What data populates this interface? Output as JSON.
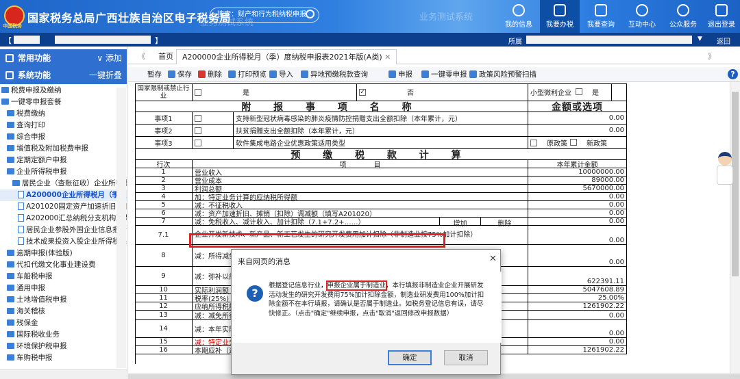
{
  "header": {
    "logo_text": "中国税务",
    "site_title": "国家税务总局广西壮族自治区电子税务局",
    "search_placeholder": "搜索：财产和行为税纳税申报",
    "watermark_left": "业务测试系统",
    "watermark_right": "业务测试系统",
    "nav": [
      {
        "label": "我的信息",
        "icon": "user-icon"
      },
      {
        "label": "我要办税",
        "icon": "monitor-icon",
        "active": true
      },
      {
        "label": "我要查询",
        "icon": "document-search-icon"
      },
      {
        "label": "互动中心",
        "icon": "chat-icon"
      },
      {
        "label": "公众服务",
        "icon": "service-icon"
      },
      {
        "label": "退出登录",
        "icon": "logout-icon"
      }
    ]
  },
  "subbar": {
    "left_bracket": "【",
    "right_bracket": "】",
    "org_label": "所属",
    "back_label": "返回"
  },
  "sidebar": {
    "common_label": "常用功能",
    "common_action": "添加",
    "system_label": "系统功能",
    "system_action": "一键折叠",
    "items": [
      {
        "label": "税费申报及缴纳",
        "indent": 0,
        "type": "folder"
      },
      {
        "label": "一键零申报套餐",
        "indent": 0,
        "type": "folder"
      },
      {
        "label": "税费缴纳",
        "indent": 1,
        "type": "folder"
      },
      {
        "label": "查询打印",
        "indent": 1,
        "type": "folder"
      },
      {
        "label": "综合申报",
        "indent": 1,
        "type": "folder"
      },
      {
        "label": "增值税及附加税费申报",
        "indent": 1,
        "type": "folder"
      },
      {
        "label": "定期定额户申报",
        "indent": 1,
        "type": "folder"
      },
      {
        "label": "企业所得税申报",
        "indent": 1,
        "type": "folder"
      },
      {
        "label": "居民企业（查账征收）企业所得税",
        "indent": 2,
        "type": "folder"
      },
      {
        "label": "A200000企业所得税月（季）度",
        "indent": 3,
        "type": "doc",
        "selected": true
      },
      {
        "label": "A201020固定资产加速折旧(扣除",
        "indent": 3,
        "type": "doc"
      },
      {
        "label": "A202000汇总纳税分支机构所得税",
        "indent": 3,
        "type": "doc"
      },
      {
        "label": "居民企业参股外国企业信息报告表",
        "indent": 3,
        "type": "doc"
      },
      {
        "label": "技术成果投资入股企业所得税递延",
        "indent": 3,
        "type": "doc"
      },
      {
        "label": "逾期申报(体验版)",
        "indent": 1,
        "type": "folder"
      },
      {
        "label": "代扣代缴文化事业建设费",
        "indent": 1,
        "type": "folder"
      },
      {
        "label": "车船税申报",
        "indent": 1,
        "type": "folder"
      },
      {
        "label": "通用申报",
        "indent": 1,
        "type": "folder"
      },
      {
        "label": "土地增值税申报",
        "indent": 1,
        "type": "folder"
      },
      {
        "label": "海关稽核",
        "indent": 1,
        "type": "folder"
      },
      {
        "label": "残保金",
        "indent": 1,
        "type": "folder"
      },
      {
        "label": "国际税收业务",
        "indent": 1,
        "type": "folder"
      },
      {
        "label": "环境保护税申报",
        "indent": 1,
        "type": "folder"
      },
      {
        "label": "车购税申报",
        "indent": 1,
        "type": "folder"
      }
    ]
  },
  "tabs": {
    "home": "首页",
    "active": "A200000企业所得税月（季）度纳税申报表2021年版(A类)",
    "prev": "《",
    "next": "》"
  },
  "toolbar": [
    {
      "label": "暂存",
      "icon": "none"
    },
    {
      "label": "保存",
      "icon": "save-icon"
    },
    {
      "label": "删除",
      "icon": "delete-icon"
    },
    {
      "label": "打印预览",
      "icon": "print-icon"
    },
    {
      "label": "导入",
      "icon": "import-icon"
    },
    {
      "label": "异地预缴税款查询",
      "icon": "query-icon"
    },
    {
      "label": "申报",
      "icon": "declare-icon"
    },
    {
      "label": "一键零申报",
      "icon": "zero-declare-icon"
    },
    {
      "label": "政策风险预警扫描",
      "icon": "scan-icon"
    }
  ],
  "form": {
    "restricted_label": "国家限制或禁止行业",
    "yes": "是",
    "no": "否",
    "small_profit_label": "小型微利企业",
    "section1_title": "附 报 事 项 名 称",
    "section1_amount": "金额或选项",
    "matters": [
      {
        "label": "事项1",
        "text": "支持新型冠状病毒感染的肺炎疫情防控捐赠支出全额扣除（本年累计，元）",
        "value": "0.00"
      },
      {
        "label": "事项2",
        "text": "扶贫捐赠支出全额扣除（本年累计，元）",
        "value": "0.00"
      },
      {
        "label": "事项3",
        "text": "软件集成电路企业优惠政策适用类型",
        "opt1": "原政策",
        "opt2": "新政策"
      }
    ],
    "section2_title": "预 缴 税 款 计 算",
    "col_no": "行次",
    "col_item": "项　　　　目",
    "col_amount": "本年累计金额",
    "add_label": "增加",
    "del_label": "删除",
    "rows": [
      {
        "no": "1",
        "item": "营业收入",
        "value": "10000000.00"
      },
      {
        "no": "2",
        "item": "营业成本",
        "value": "89000.00"
      },
      {
        "no": "3",
        "item": "利润总额",
        "value": "5670000.00"
      },
      {
        "no": "4",
        "item": "加：特定业务计算的应纳税所得额",
        "value": "0.00"
      },
      {
        "no": "5",
        "item": "减：不征税收入",
        "value": "0.00"
      },
      {
        "no": "6",
        "item": "减：资产加速折旧、摊销（扣除）调减额（填写A201020）",
        "value": "0.00"
      },
      {
        "no": "7",
        "item": "减：免税收入、减计收入、加计扣除（7.1+7.2+……）",
        "value": "0.00"
      },
      {
        "no": "7.1",
        "item": "企业开发新技术、新产品、新工艺发生的研究开发费用加计扣除（非制造业按75%加计扣除）",
        "value": "0.00"
      },
      {
        "no": "8",
        "item": "减：所得减免",
        "value": "0.00"
      },
      {
        "no": "9",
        "item": "减：弥补以前",
        "value": "622391.11"
      },
      {
        "no": "10",
        "item": "实际利润额（",
        "value": "5047608.89"
      },
      {
        "no": "11",
        "item": "税率(25%)",
        "value": "25.00%"
      },
      {
        "no": "12",
        "item": "应纳所得税额",
        "value": "1261902.22"
      },
      {
        "no": "13",
        "item": "减：减免所得",
        "value": "0.00"
      },
      {
        "no": "14",
        "item": "减：本年实际",
        "value": "0.00"
      },
      {
        "no": "15",
        "item": "减：特定业务",
        "value": "0.00"
      },
      {
        "no": "16",
        "item": "本期应补（退",
        "value": "1261902.22"
      }
    ]
  },
  "dialog": {
    "title": "来自网页的消息",
    "close": "✕",
    "msg_pre": "根据登记信息行业，",
    "msg_em": "申报企业属于制造业",
    "msg_post": "，本行填报非制造业企业开展研发活动发生的研究开发费用75%加计扣除金额，制造业研发费用100%加计扣除金额不在本行填报，请确认是否属于制造业。如税务登记信息有误，请尽快修正。（点击\"确定\"继续申报，点击\"取消\"返回修改申报数据）",
    "ok": "确定",
    "cancel": "取消"
  }
}
